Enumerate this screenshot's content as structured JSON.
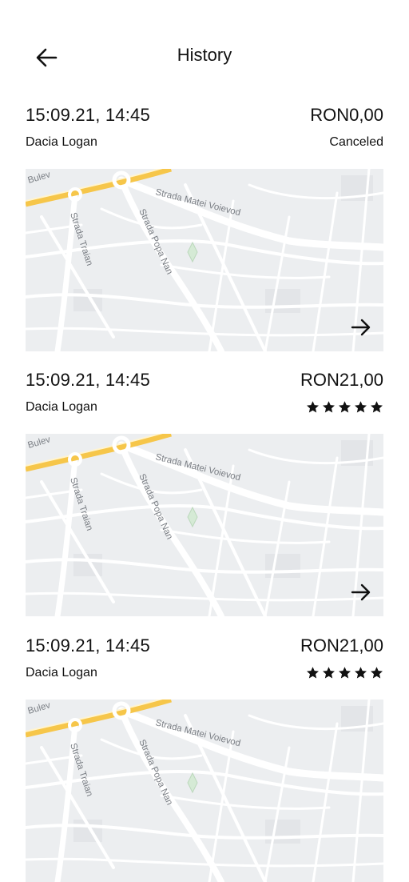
{
  "header": {
    "title": "History",
    "back_icon": "arrow-left-icon"
  },
  "map_labels": {
    "street_1": "Strada Matei Voievod",
    "street_2": "Strada Traian",
    "street_3": "Strada Popa Nan",
    "street_4": "Bulev"
  },
  "trips": [
    {
      "datetime": "15:09.21, 14:45",
      "price": "RON0,00",
      "car": "Dacia Logan",
      "status": "Canceled",
      "rating": null
    },
    {
      "datetime": "15:09.21, 14:45",
      "price": "RON21,00",
      "car": "Dacia Logan",
      "status": "",
      "rating": 5
    },
    {
      "datetime": "15:09.21, 14:45",
      "price": "RON21,00",
      "car": "Dacia Logan",
      "status": "",
      "rating": 5
    }
  ],
  "colors": {
    "map_bg": "#eceef0",
    "road": "#ffffff",
    "main_road": "#f6c64a",
    "park": "#d5ead5"
  }
}
